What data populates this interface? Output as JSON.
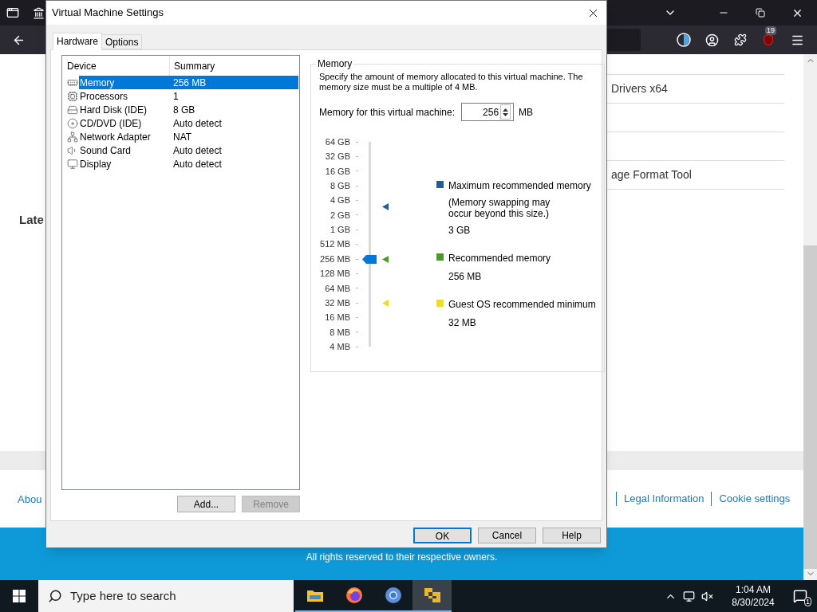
{
  "browser": {
    "badge": "19"
  },
  "page": {
    "left_heading": "Late",
    "right_items": [
      "Drivers x64",
      "age Format Tool"
    ],
    "footer_left": "Abou",
    "footer_links": [
      "Legal Information",
      "Cookie settings"
    ],
    "copyright": "All rights reserved to their respective owners."
  },
  "dialog": {
    "title": "Virtual Machine Settings",
    "tabs": [
      {
        "label": "Hardware",
        "selected": true
      },
      {
        "label": "Options",
        "selected": false
      }
    ],
    "columns": [
      "Device",
      "Summary"
    ],
    "devices": [
      {
        "kind": "memory",
        "device": "Memory",
        "summary": "256 MB",
        "selected": true
      },
      {
        "kind": "processor",
        "device": "Processors",
        "summary": "1",
        "selected": false
      },
      {
        "kind": "disk",
        "device": "Hard Disk (IDE)",
        "summary": "8 GB",
        "selected": false
      },
      {
        "kind": "cdrom",
        "device": "CD/DVD (IDE)",
        "summary": "Auto detect",
        "selected": false
      },
      {
        "kind": "network",
        "device": "Network Adapter",
        "summary": "NAT",
        "selected": false
      },
      {
        "kind": "sound",
        "device": "Sound Card",
        "summary": "Auto detect",
        "selected": false
      },
      {
        "kind": "display",
        "device": "Display",
        "summary": "Auto detect",
        "selected": false
      }
    ],
    "device_buttons": [
      {
        "label": "Add...",
        "disabled": false
      },
      {
        "label": "Remove",
        "disabled": true
      }
    ],
    "memory": {
      "title": "Memory",
      "description": "Specify the amount of memory allocated to this virtual machine. The memory size must be a multiple of 4 MB.",
      "field_label": "Memory for this virtual machine:",
      "value": "256",
      "unit": "MB",
      "scale": [
        "64 GB",
        "32 GB",
        "16 GB",
        "8 GB",
        "4 GB",
        "2 GB",
        "1 GB",
        "512 MB",
        "256 MB",
        "128 MB",
        "64 MB",
        "32 MB",
        "16 MB",
        "8 MB",
        "4 MB"
      ],
      "level": 0.4286,
      "legend": [
        {
          "label": "Maximum recommended memory",
          "note": "(Memory swapping may occur beyond this size.)",
          "value": "3 GB",
          "color": "#1f5f96",
          "level": 0.684
        },
        {
          "label": "Recommended memory",
          "value": "256 MB",
          "color": "#4b9a2a",
          "level": 0.4286
        },
        {
          "label": "Guest OS recommended minimum",
          "value": "32 MB",
          "color": "#f2dc1e",
          "level": 0.2143
        }
      ]
    },
    "buttons": [
      {
        "label": "OK",
        "default": true
      },
      {
        "label": "Cancel",
        "default": false
      },
      {
        "label": "Help",
        "default": false
      }
    ]
  },
  "taskbar": {
    "search_placeholder": "Type here to search",
    "apps": [
      {
        "kind": "files",
        "running": true,
        "selected": false
      },
      {
        "kind": "firefox",
        "running": true,
        "selected": false
      },
      {
        "kind": "chrome",
        "running": true,
        "selected": false
      },
      {
        "kind": "vmware",
        "running": true,
        "selected": true
      }
    ],
    "time": "1:04 AM",
    "date": "8/30/2024",
    "notifications": "1"
  }
}
